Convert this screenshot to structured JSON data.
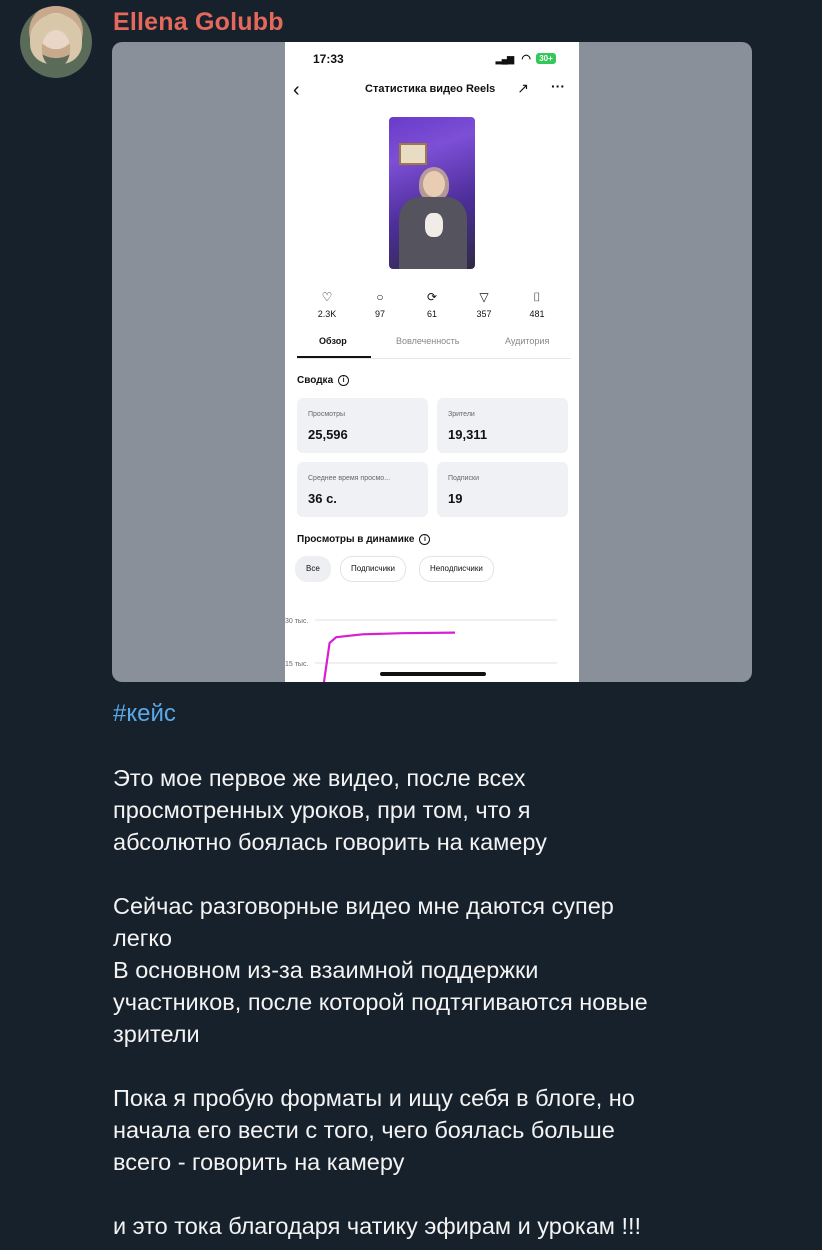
{
  "message": {
    "sender": "Ellena Golubb",
    "hashtag": "#кейс",
    "text": "Это мое первое же видео, после всех\nпросмотренных уроков, при том, что я\nабсолютно боялась говорить на камеру\n\nСейчас разговорные видео мне даются супер\nлегко\nВ основном из-за взаимной поддержки\nучастников, после которой подтягиваются новые\nзрители\n\nПока я пробую форматы и ищу себя в блоге, но\nначала его вести с того, чего боялась больше\nвсего - говорить на камеру\n\nи это тока благодаря чатику эфирам и урокам !!!"
  },
  "screenshot": {
    "status": {
      "time": "17:33",
      "battery": "30+"
    },
    "nav": {
      "title": "Статистика видео Reels"
    },
    "stats": [
      {
        "icon": "heart-icon",
        "value": "2.3K"
      },
      {
        "icon": "comment-icon",
        "value": "97"
      },
      {
        "icon": "repost-icon",
        "value": "61"
      },
      {
        "icon": "share-icon",
        "value": "357"
      },
      {
        "icon": "bookmark-icon",
        "value": "481"
      }
    ],
    "tabs": [
      "Обзор",
      "Вовлеченность",
      "Аудитория"
    ],
    "summary_title": "Сводка",
    "cards": [
      {
        "label": "Просмотры",
        "value": "25,596"
      },
      {
        "label": "Зрители",
        "value": "19,311"
      },
      {
        "label": "Среднее время просмо...",
        "value": "36 с."
      },
      {
        "label": "Подписки",
        "value": "19"
      }
    ],
    "dynamics_title": "Просмотры в динамике",
    "chips": [
      "Все",
      "Подписчики",
      "Неподписчики"
    ]
  },
  "chart_data": {
    "type": "line",
    "y_tick_labels": [
      "30 тыс.",
      "15 тыс."
    ],
    "ylim": [
      0,
      30000
    ],
    "series": [
      {
        "color": "#d61fd0",
        "x": [
          0,
          0.5,
          1,
          3,
          6,
          10
        ],
        "y": [
          6000,
          22000,
          24000,
          25000,
          25400,
          25596
        ]
      }
    ]
  }
}
